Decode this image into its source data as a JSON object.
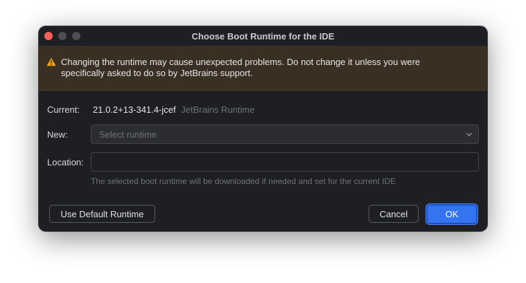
{
  "window": {
    "title": "Choose Boot Runtime for the IDE"
  },
  "banner": {
    "icon": "warning-icon",
    "text": "Changing the runtime may cause unexpected problems. Do not change it unless you were specifically asked to do so by JetBrains support."
  },
  "form": {
    "current_label": "Current:",
    "current_version": "21.0.2+13-341.4-jcef",
    "current_runtime_name": "JetBrains Runtime",
    "new_label": "New:",
    "new_select_value": "Select runtime",
    "location_label": "Location:",
    "location_value": "",
    "hint": "The selected boot runtime will be downloaded if needed and set for the current IDE"
  },
  "buttons": {
    "use_default": "Use Default Runtime",
    "cancel": "Cancel",
    "ok": "OK"
  },
  "colors": {
    "accent": "#3574f0",
    "close": "#ff5f57",
    "warning": "#f0a30a"
  }
}
